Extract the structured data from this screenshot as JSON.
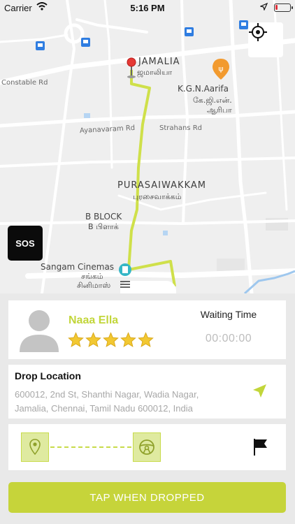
{
  "status_bar": {
    "carrier": "Carrier",
    "time": "5:16 PM",
    "battery_level": 0.15,
    "battery_color": "#e0303a"
  },
  "map": {
    "area_labels": {
      "jamalia_en": "JAMALIA",
      "jamalia_ta": "ஜமாலியா",
      "kgn_en": "K.G.N.Aarifa",
      "kgn_ta_1": "கே.ஜி.என்.",
      "kgn_ta_2": "ஆரிபா",
      "purasaiwakkam_en": "PURASAIWAKKAM",
      "purasaiwakkam_ta": "புரசைவாக்கம்",
      "bblock_en": "B BLOCK",
      "bblock_ta": "B பிளாக்",
      "sangam_en": "Sangam Cinemas",
      "sangam_ta_1": "சங்கம்",
      "sangam_ta_2": "சினிமாஸ்"
    },
    "road_labels": {
      "constable": "Constable Rd",
      "ayanavaram": "Ayanavaram Rd",
      "strahans": "Strahans Rd"
    },
    "route_color": "#cfe04a",
    "icons": [
      "target-icon",
      "map-pin-icon",
      "restaurant-icon",
      "cinema-icon",
      "transit-icon"
    ]
  },
  "sos": {
    "label": "SOS"
  },
  "driver": {
    "name": "Naaa Ella",
    "rating": 5,
    "rating_max": 5,
    "waiting_label": "Waiting Time",
    "waiting_value": "00:00:00",
    "accent": "#c2d63a"
  },
  "drop": {
    "title": "Drop Location",
    "address": "600012, 2nd St, Shanthi Nagar, Wadia Nagar, Jamalia, Chennai, Tamil Nadu 600012, India"
  },
  "trip_progress": {
    "icons": [
      "location-pin-icon",
      "steering-wheel-icon",
      "flag-icon"
    ]
  },
  "action": {
    "label": "TAP WHEN DROPPED",
    "color": "#c6d43a"
  }
}
